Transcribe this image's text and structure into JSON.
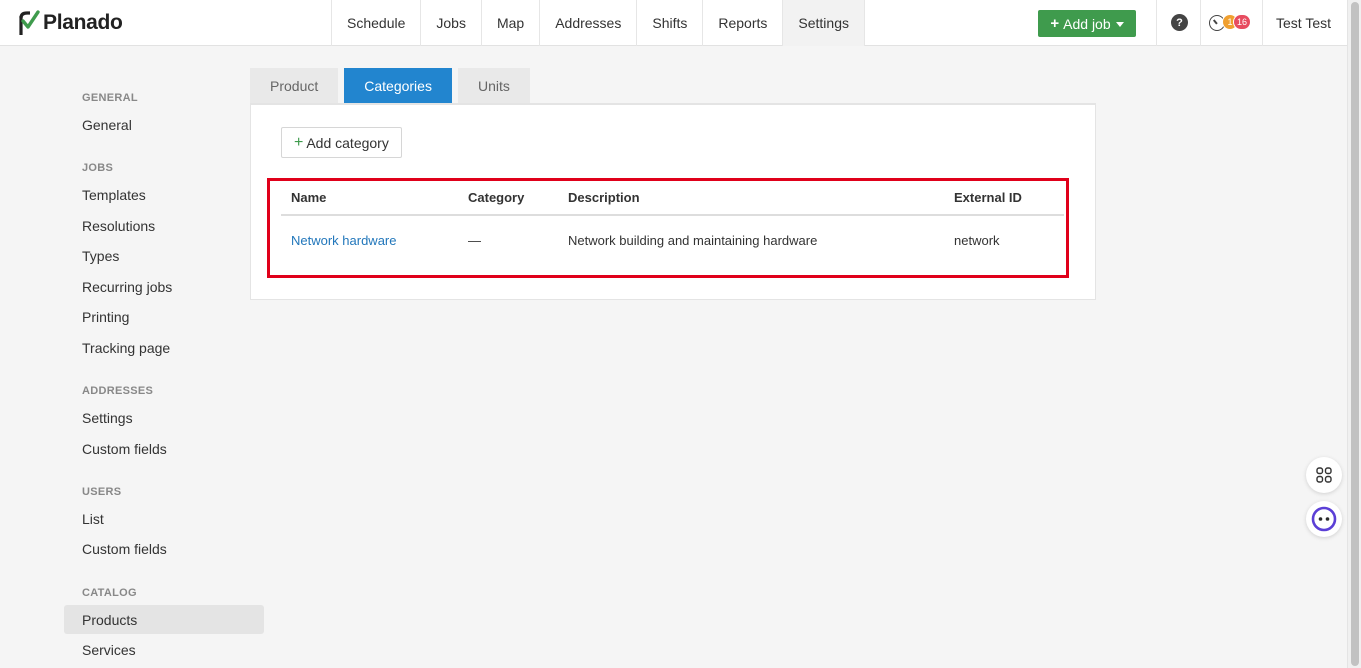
{
  "app": {
    "logo_text": "Planado",
    "brand_color": "#3f9b4d",
    "accent_color": "#2285cf"
  },
  "nav": {
    "items": [
      {
        "label": "Schedule"
      },
      {
        "label": "Jobs"
      },
      {
        "label": "Map"
      },
      {
        "label": "Addresses"
      },
      {
        "label": "Shifts"
      },
      {
        "label": "Reports"
      },
      {
        "label": "Settings"
      }
    ],
    "add_job_label": "Add job",
    "help_icon": "?",
    "notif_badge_1": "1",
    "notif_badge_2": "16",
    "user_name": "Test Test"
  },
  "sidebar": {
    "general_title": "GENERAL",
    "general_item": "General",
    "jobs_title": "JOBS",
    "jobs_items": [
      "Templates",
      "Resolutions",
      "Types",
      "Recurring jobs",
      "Printing",
      "Tracking page"
    ],
    "addresses_title": "ADDRESSES",
    "addresses_items": [
      "Settings",
      "Custom fields"
    ],
    "users_title": "USERS",
    "users_items": [
      "List",
      "Custom fields"
    ],
    "catalog_title": "CATALOG",
    "catalog_items": [
      "Products",
      "Services"
    ]
  },
  "tabs": [
    "Product",
    "Categories",
    "Units"
  ],
  "toolbar": {
    "add_category_label": "Add category"
  },
  "table": {
    "headers": [
      "Name",
      "Category",
      "Description",
      "External ID"
    ],
    "rows": [
      {
        "name": "Network hardware",
        "category": "—",
        "description": "Network building and maintaining hardware",
        "external_id": "network"
      }
    ]
  }
}
